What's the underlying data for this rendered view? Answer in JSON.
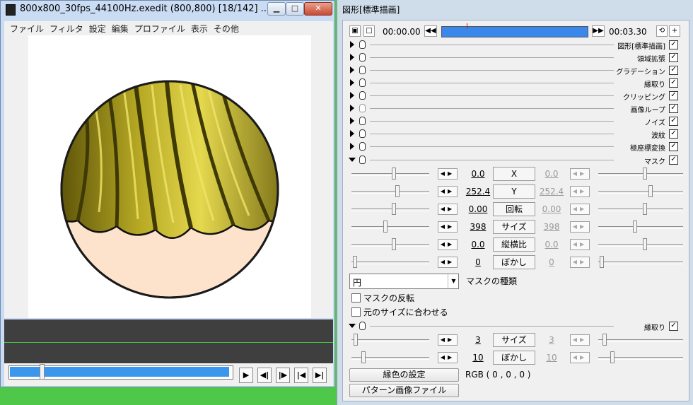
{
  "left_window": {
    "title": "800x800_30fps_44100Hz.exedit (800,800)  [18/142]  ...",
    "controls": {
      "minimize": "▁",
      "maximize": "□",
      "close": "✕"
    },
    "menu": [
      "ファイル",
      "フィルタ",
      "設定",
      "編集",
      "プロファイル",
      "表示",
      "その他"
    ],
    "seek_position": 0.14,
    "playback_buttons": [
      "play-icon",
      "prev-frame-icon",
      "next-frame-icon",
      "first-frame-icon",
      "last-frame-icon"
    ],
    "colors": {
      "hair": "#a89a20",
      "hair_highlight": "#e2d64a",
      "skin": "#fde3cb",
      "outline": "#1a1a1a",
      "track_bg": "#3f3f3f",
      "seek_fill": "#3b96ee"
    }
  },
  "right_window": {
    "title": "図形[標準描画]",
    "time_start": "00:00.00",
    "time_end": "00:03.30",
    "timeline_marker_position": 0.17,
    "collapsed_filters": [
      {
        "label": "図形[標準描画]",
        "checked": true
      },
      {
        "label": "領域拡張",
        "checked": true
      },
      {
        "label": "グラデーション",
        "checked": true
      },
      {
        "label": "縁取り",
        "checked": true
      },
      {
        "label": "クリッピング",
        "checked": true
      },
      {
        "label": "画像ループ",
        "checked": true
      },
      {
        "label": "ノイズ",
        "checked": true
      },
      {
        "label": "波紋",
        "checked": true
      },
      {
        "label": "極座標変換",
        "checked": true
      }
    ],
    "mask": {
      "header": "マスク",
      "checked": true,
      "params": [
        {
          "name": "X",
          "start": "0.0",
          "end": "0.0",
          "lpos": 0.55,
          "rpos": 0.55
        },
        {
          "name": "Y",
          "start": "252.4",
          "end": "252.4",
          "lpos": 0.6,
          "rpos": 0.62
        },
        {
          "name": "回転",
          "start": "0.00",
          "end": "0.00",
          "lpos": 0.55,
          "rpos": 0.55
        },
        {
          "name": "サイズ",
          "start": "398",
          "end": "398",
          "lpos": 0.43,
          "rpos": 0.43
        },
        {
          "name": "縦横比",
          "start": "0.0",
          "end": "0.0",
          "lpos": 0.55,
          "rpos": 0.55
        },
        {
          "name": "ぼかし",
          "start": "0",
          "end": "0",
          "lpos": 0.02,
          "rpos": 0.02
        }
      ],
      "type_value": "円",
      "type_label": "マスクの種類",
      "invert_label": "マスクの反転",
      "fit_label": "元のサイズに合わせる"
    },
    "border": {
      "header": "縁取り",
      "checked": true,
      "params": [
        {
          "name": "サイズ",
          "start": "3",
          "end": "3",
          "lpos": 0.03,
          "rpos": 0.05
        },
        {
          "name": "ぼかし",
          "start": "10",
          "end": "10",
          "lpos": 0.13,
          "rpos": 0.15
        }
      ],
      "color_button": "縁色の設定",
      "rgb_text": "RGB ( 0 , 0 , 0 )",
      "pattern_button": "パターン画像ファイル"
    },
    "colors": {
      "timeline": "#3b88ec",
      "marker": "#e01010"
    }
  }
}
